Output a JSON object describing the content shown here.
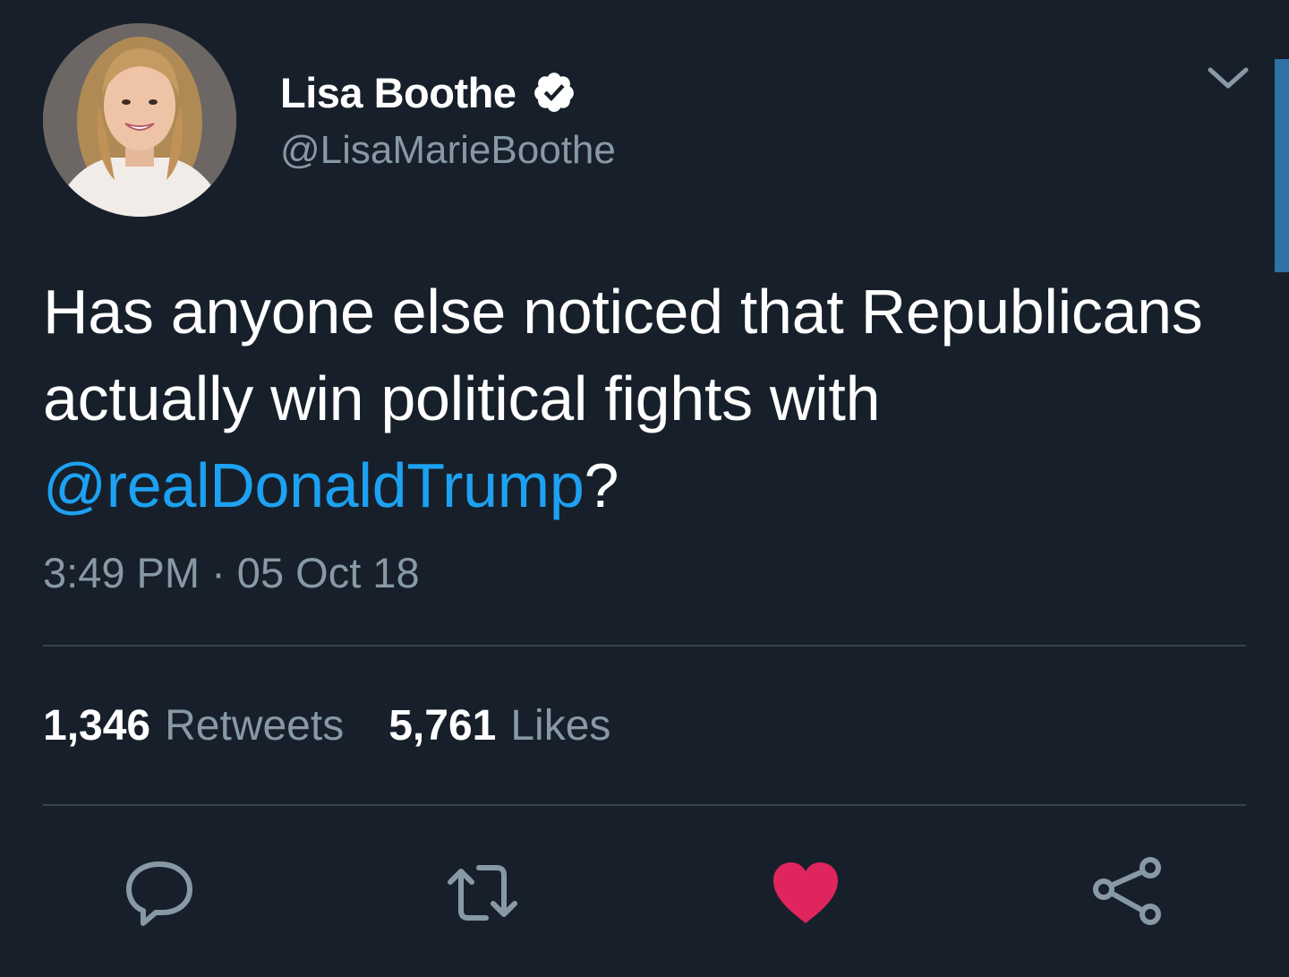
{
  "author": {
    "display_name": "Lisa Boothe",
    "handle": "@LisaMarieBoothe",
    "verified": true
  },
  "tweet": {
    "text_before": "Has anyone else noticed that Republicans actually win political fights with ",
    "mention": "@realDonaldTrump",
    "text_after": "?",
    "timestamp": "3:49 PM · 05 Oct 18"
  },
  "stats": {
    "retweets_count": "1,346",
    "retweets_label": "Retweets",
    "likes_count": "5,761",
    "likes_label": "Likes"
  },
  "actions": [
    "reply-icon",
    "retweet-icon",
    "heart-icon",
    "share-icon"
  ],
  "colors": {
    "background": "#17202a",
    "text": "#ffffff",
    "muted": "#8899a6",
    "link": "#1da1f2",
    "like": "#e0245e",
    "divider": "#38444d"
  }
}
